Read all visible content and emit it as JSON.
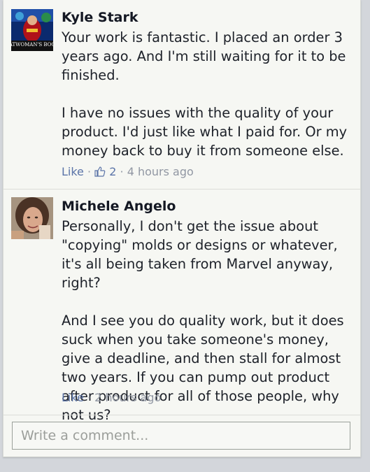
{
  "comments": [
    {
      "author": "Kyle Stark",
      "avatar_caption": "ATWOMAN'S BOO",
      "text": "Your work is fantastic. I placed an order 3 years ago. And I'm still waiting for it to be finished.\n\nI have no issues with the quality of your product. I'd just like what I paid for. Or my money back to buy it from someone else.",
      "like_label": "Like",
      "like_count": "2",
      "time": "4 hours ago"
    },
    {
      "author": "Michele Angelo",
      "text": "Personally, I don't get the issue about \"copying\" molds or designs or whatever, it's all being taken from Marvel anyway, right?\n\nAnd I see you do quality work, but it does suck when you take someone's money, give a deadline, and then stall for almost two years. If you can pump out product after product for all of those people, why not us?",
      "like_label": "Like",
      "time": "2 hours ago"
    }
  ],
  "composer": {
    "placeholder": "Write a comment..."
  },
  "colors": {
    "link": "#5b74a8",
    "meta": "#9197a3",
    "background": "#f6f7f3"
  }
}
